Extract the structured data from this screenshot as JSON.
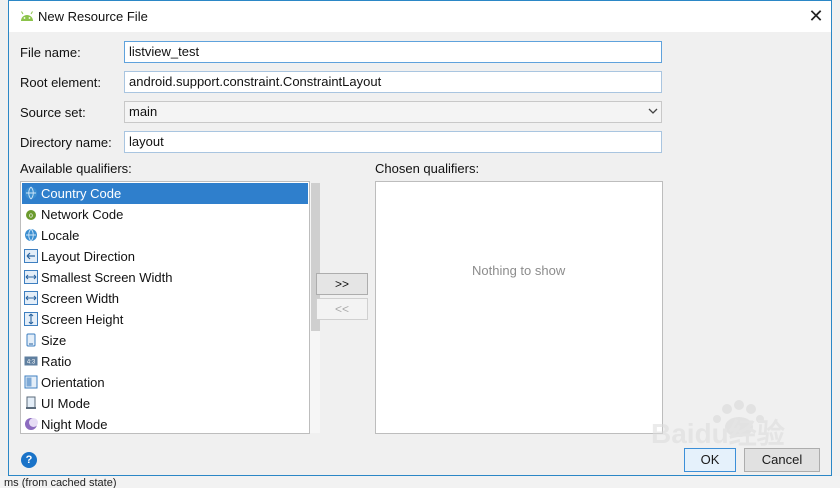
{
  "window": {
    "title": "New Resource File"
  },
  "form": {
    "file_name": {
      "label": "File name:",
      "value": "listview_test"
    },
    "root_element": {
      "label": "Root element:",
      "value": "android.support.constraint.ConstraintLayout"
    },
    "source_set": {
      "label": "Source set:",
      "value": "main"
    },
    "directory_name": {
      "label": "Directory name:",
      "value": "layout"
    }
  },
  "available": {
    "label": "Available qualifiers:",
    "items": [
      {
        "label": "Country Code",
        "icon": "globe-icon"
      },
      {
        "label": "Network Code",
        "icon": "network-icon"
      },
      {
        "label": "Locale",
        "icon": "globe-icon"
      },
      {
        "label": "Layout Direction",
        "icon": "direction-icon"
      },
      {
        "label": "Smallest Screen Width",
        "icon": "width-icon"
      },
      {
        "label": "Screen Width",
        "icon": "width-icon"
      },
      {
        "label": "Screen Height",
        "icon": "height-icon"
      },
      {
        "label": "Size",
        "icon": "size-icon"
      },
      {
        "label": "Ratio",
        "icon": "ratio-icon"
      },
      {
        "label": "Orientation",
        "icon": "orientation-icon"
      },
      {
        "label": "UI Mode",
        "icon": "ui-mode-icon"
      },
      {
        "label": "Night Mode",
        "icon": "moon-icon"
      }
    ],
    "selected_index": 0
  },
  "chosen": {
    "label": "Chosen qualifiers:",
    "empty_text": "Nothing to show"
  },
  "buttons": {
    "add": ">>",
    "remove": "<<",
    "ok": "OK",
    "cancel": "Cancel",
    "help": "?"
  },
  "background": {
    "status_text": "ms (from cached state)"
  },
  "colors": {
    "accent": "#2f7fcc",
    "border_focus": "#5fa2dc"
  },
  "watermark_text": "Baidu经验"
}
